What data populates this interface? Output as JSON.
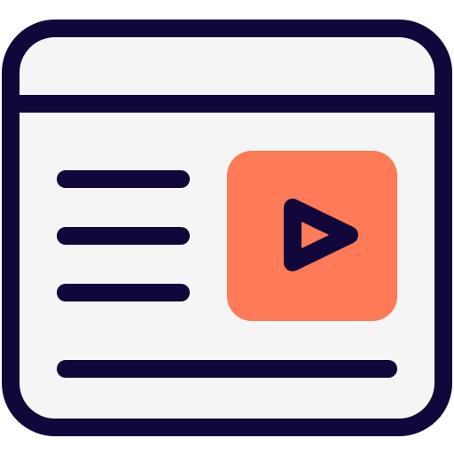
{
  "icon": {
    "name": "video-web-page-icon",
    "colors": {
      "stroke": "#11073A",
      "accent": "#FF7A56",
      "window_fill": "#F5F5F5",
      "background": "#FFFFFF"
    }
  }
}
